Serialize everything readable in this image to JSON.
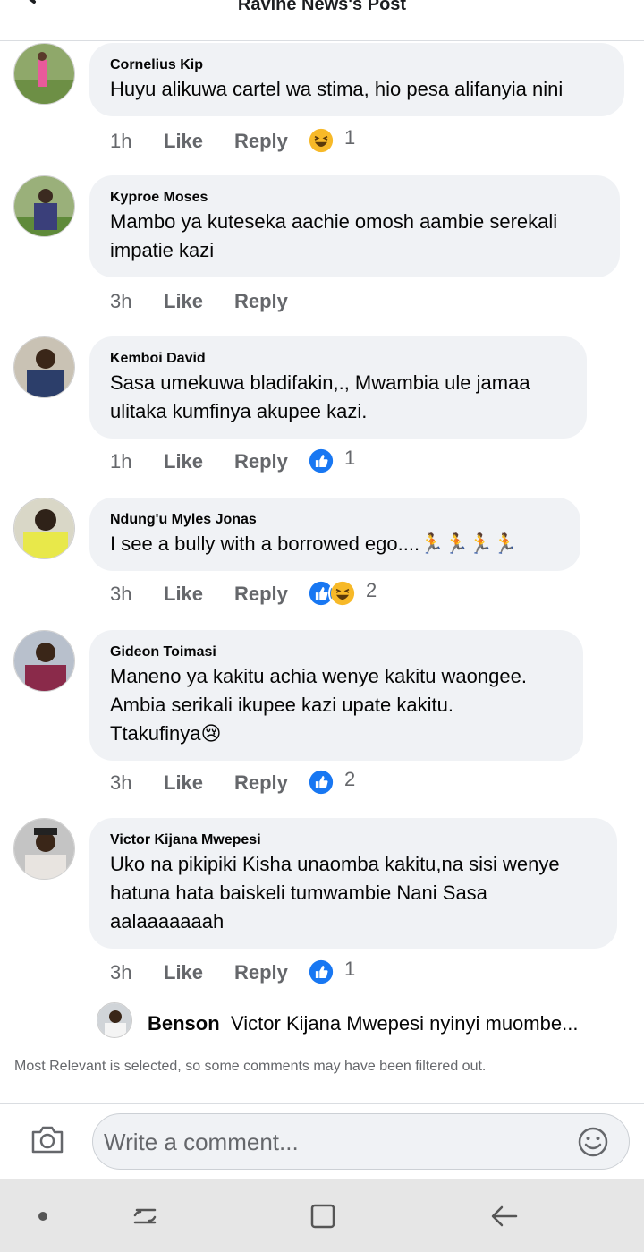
{
  "header": {
    "title": "Ravine News's Post"
  },
  "comments": [
    {
      "author": "Cornelius Kip",
      "lines": [
        "Huyu alikuwa cartel wa stima, hio pesa alifanyia nini"
      ],
      "time": "1h",
      "like": "Like",
      "reply": "Reply",
      "reaction_icons": [
        "haha-icon"
      ],
      "reaction_count": "1"
    },
    {
      "author": "Kyproe Moses",
      "lines": [
        "Mambo ya kuteseka aachie omosh aambie serekali",
        "impatie kazi"
      ],
      "time": "3h",
      "like": "Like",
      "reply": "Reply",
      "reaction_icons": [],
      "reaction_count": ""
    },
    {
      "author": "Kemboi David",
      "lines": [
        "Sasa umekuwa bladifakin,., Mwambia ule jamaa",
        "ulitaka kumfinya akupee kazi."
      ],
      "time": "1h",
      "like": "Like",
      "reply": "Reply",
      "reaction_icons": [
        "like-icon"
      ],
      "reaction_count": "1"
    },
    {
      "author": "Ndung'u Myles Jonas",
      "lines": [
        "I see a bully with a borrowed ego....🏃🏃🏃🏃"
      ],
      "time": "3h",
      "like": "Like",
      "reply": "Reply",
      "reaction_icons": [
        "like-icon",
        "haha-icon"
      ],
      "reaction_count": "2"
    },
    {
      "author": "Gideon Toimasi",
      "lines": [
        "Maneno ya kakitu achia wenye kakitu waongee.",
        "Ambia serikali ikupee kazi upate kakitu.",
        "Ttakufinya😢"
      ],
      "time": "3h",
      "like": "Like",
      "reply": "Reply",
      "reaction_icons": [
        "like-icon"
      ],
      "reaction_count": "2"
    },
    {
      "author": "Victor Kijana Mwepesi",
      "lines": [
        "Uko na pikipiki Kisha unaomba kakitu,na sisi wenye",
        "hatuna hata  baiskeli tumwambie Nani Sasa",
        "aalaaaaaaah"
      ],
      "time": "3h",
      "like": "Like",
      "reply": "Reply",
      "reaction_icons": [
        "like-icon"
      ],
      "reaction_count": "1"
    }
  ],
  "reply_preview": {
    "author": "Benson",
    "text": "Victor Kijana Mwepesi nyinyi muombe..."
  },
  "notice": "Most Relevant is selected, so some comments may have been filtered out.",
  "composer": {
    "placeholder": "Write a comment..."
  },
  "colors": {
    "like_blue": "#1877f2",
    "haha_yellow": "#f7b928",
    "meta_gray": "#65676b",
    "bubble_bg": "#f0f2f5"
  }
}
